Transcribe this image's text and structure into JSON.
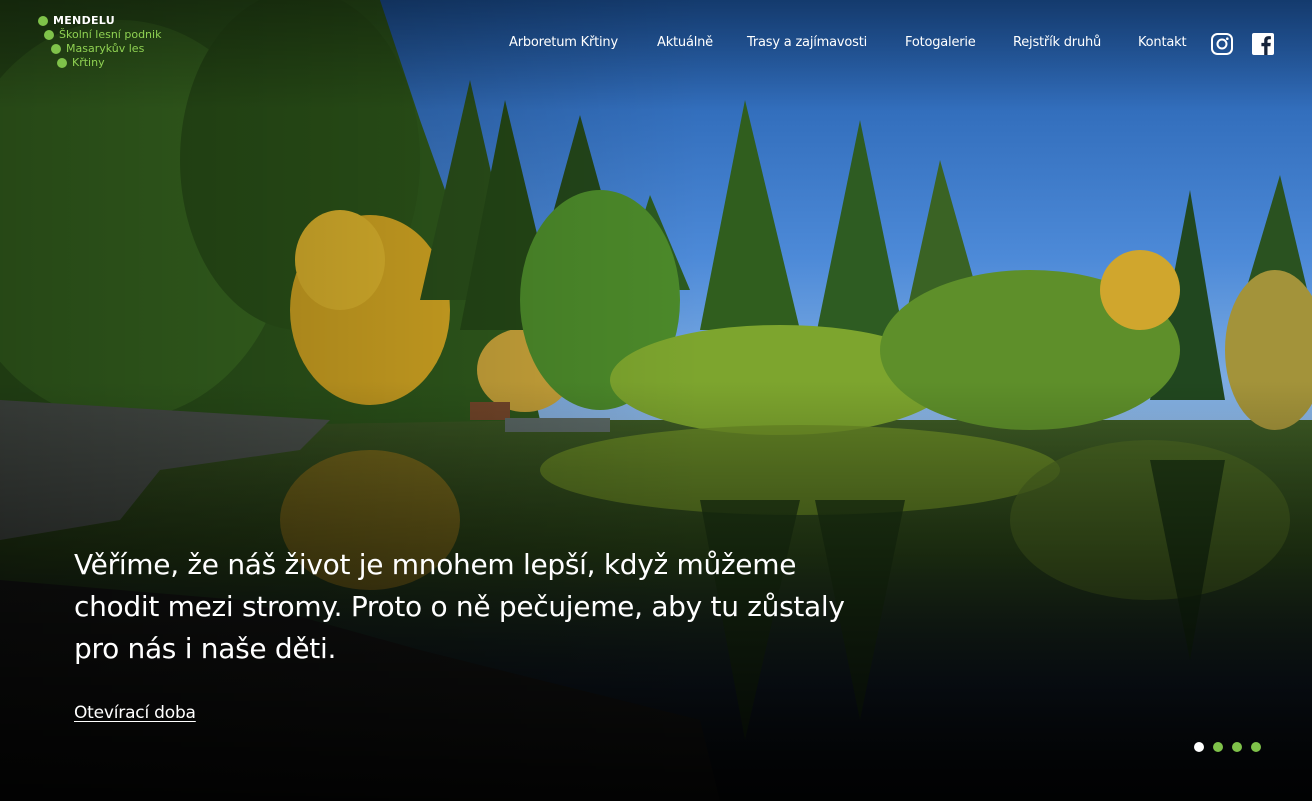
{
  "logo": {
    "lines": [
      "MENDELU",
      "Školní lesní podnik",
      "Masarykův les",
      "Křtiny"
    ],
    "accent_color": "#7fc24a"
  },
  "nav": {
    "items": [
      {
        "label": "Arboretum Křtiny"
      },
      {
        "label": "Aktuálně"
      },
      {
        "label": "Trasy a zajímavosti"
      },
      {
        "label": "Fotogalerie"
      },
      {
        "label": "Rejstřík druhů"
      },
      {
        "label": "Kontakt"
      }
    ],
    "social": [
      {
        "icon": "instagram-icon"
      },
      {
        "icon": "facebook-icon"
      }
    ]
  },
  "hero": {
    "headline": "Věříme, že náš život je mnohem lepší, když můžeme chodit mezi stromy. Proto o ně pečujeme, aby tu zůstaly pro nás i naše děti.",
    "cta_label": "Otevírací doba",
    "slides_total": 4,
    "active_slide": 1,
    "dot_active_color": "#ffffff",
    "dot_inactive_color": "#7fc24a"
  }
}
